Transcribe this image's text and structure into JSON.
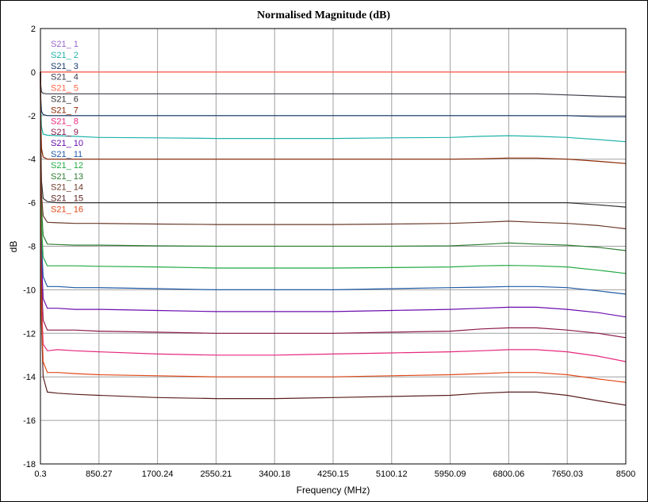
{
  "chart_data": {
    "type": "line",
    "title": "Normalised Magnitude (dB)",
    "xlabel": "Frequency (MHz)",
    "ylabel": "dB",
    "xlim": [
      0.3,
      8500
    ],
    "ylim": [
      -18,
      2
    ],
    "x_ticks": [
      "0.3",
      "850.27",
      "1700.24",
      "2550.21",
      "3400.18",
      "4250.15",
      "5100.12",
      "5950.09",
      "6800.06",
      "7650.03",
      "8500"
    ],
    "y_ticks": [
      2,
      0,
      -2,
      -4,
      -6,
      -8,
      -10,
      -12,
      -14,
      -16,
      -18
    ],
    "grid": true,
    "legend": "top-left",
    "x": [
      0.3,
      5,
      15,
      40,
      100,
      250,
      500,
      850.27,
      1700.24,
      2550.21,
      3400.18,
      4250.15,
      5100.12,
      5950.09,
      6400,
      6800.06,
      7200,
      7650.03,
      8100,
      8500
    ],
    "series": [
      {
        "name": "S21_ 1",
        "color": "#9966cc",
        "values": [
          0,
          0,
          0,
          0,
          0,
          0,
          0,
          0,
          0,
          0,
          0,
          0,
          0,
          0,
          0,
          0,
          0,
          0,
          0,
          0
        ]
      },
      {
        "name": "S21_ 2",
        "color": "#20b2aa",
        "values": [
          0,
          -1.6,
          -2.5,
          -2.85,
          -2.9,
          -2.92,
          -2.95,
          -3.0,
          -3.02,
          -3.05,
          -3.05,
          -3.05,
          -3.02,
          -3.0,
          -2.95,
          -2.92,
          -2.95,
          -3.0,
          -3.1,
          -3.2
        ]
      },
      {
        "name": "S21_ 3",
        "color": "#1a3a6a",
        "values": [
          0,
          -1.2,
          -1.8,
          -1.95,
          -2.0,
          -2.0,
          -2.0,
          -2.0,
          -2.0,
          -2.0,
          -2.0,
          -2.0,
          -2.0,
          -2.0,
          -2.0,
          -2.0,
          -2.0,
          -2.0,
          -2.05,
          -2.05
        ]
      },
      {
        "name": "S21_ 4",
        "color": "#3a3a4a",
        "values": [
          0,
          -0.6,
          -0.9,
          -0.98,
          -1.0,
          -1.0,
          -1.0,
          -1.0,
          -1.0,
          -1.0,
          -1.0,
          -1.0,
          -1.0,
          -1.0,
          -1.0,
          -1.0,
          -1.0,
          -1.05,
          -1.1,
          -1.15
        ]
      },
      {
        "name": "S21_ 5",
        "color": "#ff6347",
        "values": [
          0,
          0,
          0,
          0,
          0,
          0,
          0,
          0,
          0,
          0,
          0,
          0,
          0,
          0,
          0,
          0,
          0,
          0,
          0,
          0
        ]
      },
      {
        "name": "S21_ 6",
        "color": "#333333",
        "values": [
          0,
          -3.0,
          -5.0,
          -5.8,
          -5.95,
          -6.0,
          -6.0,
          -6.0,
          -6.0,
          -6.0,
          -6.0,
          -6.0,
          -6.0,
          -6.0,
          -6.0,
          -6.0,
          -6.0,
          -6.0,
          -6.1,
          -6.2
        ]
      },
      {
        "name": "S21_ 7",
        "color": "#8b2500",
        "values": [
          0,
          -2.2,
          -3.5,
          -3.9,
          -4.0,
          -4.0,
          -4.0,
          -4.0,
          -4.0,
          -4.0,
          -4.0,
          -4.0,
          -4.0,
          -4.0,
          -3.98,
          -3.95,
          -3.95,
          -4.0,
          -4.1,
          -4.2
        ]
      },
      {
        "name": "S21_ 8",
        "color": "#e6287d",
        "values": [
          0,
          -6.0,
          -10.5,
          -12.5,
          -12.8,
          -12.75,
          -12.8,
          -12.85,
          -12.95,
          -13.0,
          -13.0,
          -12.95,
          -12.9,
          -12.85,
          -12.8,
          -12.75,
          -12.75,
          -12.85,
          -13.05,
          -13.3
        ]
      },
      {
        "name": "S21_ 9",
        "color": "#8b1a4a",
        "values": [
          0,
          -5.5,
          -9.5,
          -11.4,
          -11.85,
          -11.85,
          -11.85,
          -11.9,
          -11.95,
          -12.0,
          -12.0,
          -12.0,
          -11.95,
          -11.9,
          -11.8,
          -11.75,
          -11.75,
          -11.85,
          -12.0,
          -12.2
        ]
      },
      {
        "name": "S21_ 10",
        "color": "#6a0dad",
        "values": [
          0,
          -5.0,
          -8.5,
          -10.4,
          -10.85,
          -10.85,
          -10.9,
          -10.9,
          -10.95,
          -11.0,
          -11.0,
          -11.0,
          -10.95,
          -10.9,
          -10.85,
          -10.8,
          -10.8,
          -10.9,
          -11.05,
          -11.25
        ]
      },
      {
        "name": "S21_ 11",
        "color": "#1f5aa6",
        "values": [
          0,
          -4.5,
          -7.8,
          -9.4,
          -9.85,
          -9.85,
          -9.9,
          -9.9,
          -9.95,
          -10.0,
          -10.0,
          -10.0,
          -9.95,
          -9.9,
          -9.88,
          -9.85,
          -9.85,
          -9.9,
          -10.05,
          -10.2
        ]
      },
      {
        "name": "S21_ 12",
        "color": "#22aa44",
        "values": [
          0,
          -4.0,
          -7.0,
          -8.5,
          -8.9,
          -8.9,
          -8.9,
          -8.92,
          -8.95,
          -9.0,
          -9.0,
          -9.0,
          -8.98,
          -8.95,
          -8.9,
          -8.88,
          -8.9,
          -8.95,
          -9.1,
          -9.25
        ]
      },
      {
        "name": "S21_ 13",
        "color": "#2e7d32",
        "values": [
          0,
          -3.6,
          -6.2,
          -7.5,
          -7.9,
          -7.92,
          -7.95,
          -7.95,
          -7.98,
          -8.0,
          -8.0,
          -8.0,
          -8.0,
          -7.98,
          -7.92,
          -7.85,
          -7.9,
          -7.95,
          -8.05,
          -8.2
        ]
      },
      {
        "name": "S21_ 14",
        "color": "#6b3a2a",
        "values": [
          0,
          -3.3,
          -5.6,
          -6.6,
          -6.9,
          -6.92,
          -6.95,
          -6.95,
          -6.98,
          -7.0,
          -7.0,
          -7.0,
          -6.98,
          -6.95,
          -6.9,
          -6.85,
          -6.9,
          -6.95,
          -7.05,
          -7.2
        ]
      },
      {
        "name": "S21_ 15",
        "color": "#5a2020",
        "values": [
          0,
          -7.0,
          -11.5,
          -14.0,
          -14.7,
          -14.75,
          -14.8,
          -14.85,
          -14.95,
          -15.0,
          -15.0,
          -14.95,
          -14.9,
          -14.85,
          -14.75,
          -14.7,
          -14.7,
          -14.85,
          -15.1,
          -15.3
        ]
      },
      {
        "name": "S21_ 16",
        "color": "#e04a1a",
        "values": [
          0,
          -6.5,
          -11.0,
          -13.3,
          -13.8,
          -13.8,
          -13.85,
          -13.9,
          -13.95,
          -14.0,
          -14.0,
          -14.0,
          -13.95,
          -13.9,
          -13.85,
          -13.8,
          -13.8,
          -13.9,
          -14.1,
          -14.25
        ]
      }
    ]
  }
}
